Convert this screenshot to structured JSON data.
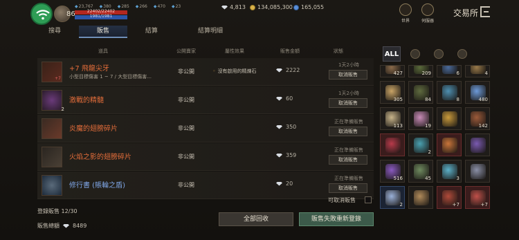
{
  "player": {
    "level": "86",
    "hp": "22402/22402",
    "mp": "1981/1981",
    "hp_pct": 1.0,
    "mp_pct": 1.0,
    "stats": [
      "23,767",
      "380",
      "285",
      "266",
      "470",
      "23"
    ]
  },
  "currency": {
    "diamonds": "4,813",
    "gold": "134,085,300",
    "gems": "165,055"
  },
  "header": {
    "world_label": "世界",
    "server_label": "伺服器",
    "title": "交易所"
  },
  "tabs": [
    "搜尋",
    "販售",
    "結算",
    "結算明細"
  ],
  "table": {
    "headers": [
      "道具",
      "公開賣家",
      "屬性效果",
      "販售金額",
      "狀態"
    ],
    "rows": [
      {
        "name": "+7 飛龍尖牙",
        "desc": "小型目標傷害 1 ~ 7 / 大型目標傷害...",
        "enchant": "+7",
        "count": "",
        "public": "非公開",
        "attr": "沒有啟用的精煉石",
        "price": "2222",
        "status": "1天2小時",
        "action": "取消販售",
        "color": "#e36d3a"
      },
      {
        "name": "激戰的精髓",
        "desc": "",
        "enchant": "",
        "count": "2",
        "public": "非公開",
        "attr": "",
        "price": "60",
        "status": "1天2小時",
        "action": "取消販售",
        "color": "#e36d3a"
      },
      {
        "name": "炎魔的翅膀碎片",
        "desc": "",
        "enchant": "",
        "count": "",
        "public": "非公開",
        "attr": "",
        "price": "350",
        "status": "正在準備販售",
        "action": "取消販售",
        "color": "#e36d3a"
      },
      {
        "name": "火焰之影的翅膀碎片",
        "desc": "",
        "enchant": "",
        "count": "",
        "public": "非公開",
        "attr": "",
        "price": "359",
        "status": "正在準備販售",
        "action": "取消販售",
        "color": "#e36d3a"
      },
      {
        "name": "修行書 (賬輪之盾)",
        "desc": "",
        "enchant": "",
        "count": "",
        "public": "非公開",
        "attr": "",
        "price": "20",
        "status": "正在準備販售",
        "action": "取消販售",
        "color": "#7fa6e6"
      }
    ]
  },
  "footer": {
    "cancelable_label": "可取消販售",
    "registered_label": "登錄販售",
    "registered_value": "12/30",
    "total_label": "販售總額",
    "total_value": "8489",
    "recall_all": "全部回收",
    "relist": "販售失敗重新登錄"
  },
  "inventory": {
    "tabs": [
      "ALL",
      "helmet-icon",
      "pouch-icon",
      "ring-icon"
    ],
    "slots": [
      {
        "n": "427",
        "c": "#8a6a4a",
        "top": true
      },
      {
        "n": "209",
        "c": "#5a6a3a",
        "top": true
      },
      {
        "n": "6",
        "c": "#4a6a9a",
        "top": true
      },
      {
        "n": "4",
        "c": "#9a7a4a",
        "top": true
      },
      {
        "n": "305",
        "c": "#c9a466"
      },
      {
        "n": "84",
        "c": "#5f6b3f"
      },
      {
        "n": "8",
        "c": "#4e8fb0"
      },
      {
        "n": "480",
        "c": "#6d9ad8"
      },
      {
        "n": "113",
        "c": "#c8b48a"
      },
      {
        "n": "19",
        "c": "#c88bb7"
      },
      {
        "n": "",
        "c": "#c99a3c"
      },
      {
        "n": "142",
        "c": "#9c5a3a"
      },
      {
        "n": "",
        "c": "#b83a4a",
        "red": true
      },
      {
        "n": "2",
        "c": "#4aa0b0"
      },
      {
        "n": "",
        "c": "#c8743a",
        "red": true
      },
      {
        "n": "",
        "c": "#7a5ab0"
      },
      {
        "n": "516",
        "c": "#8a5ac0"
      },
      {
        "n": "45",
        "c": "#6f8a5f"
      },
      {
        "n": "3",
        "c": "#5cb0c8"
      },
      {
        "n": "",
        "c": "#8a8fa6"
      },
      {
        "n": "2",
        "c": "#9ab0d8",
        "blue": true
      },
      {
        "n": "",
        "c": "#b08a5a"
      },
      {
        "n": "+7",
        "c": "#b04a3a",
        "e": true,
        "red": true
      },
      {
        "n": "+7",
        "c": "#c0504a",
        "e": true,
        "red": true
      }
    ]
  }
}
